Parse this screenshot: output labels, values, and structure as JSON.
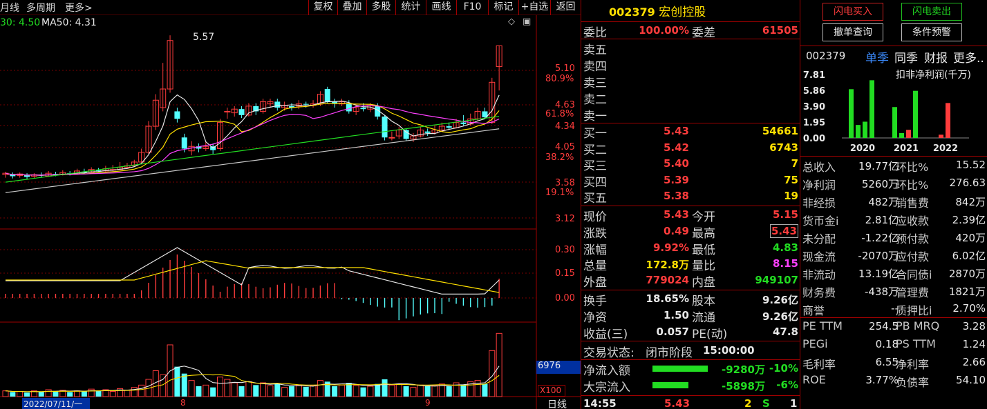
{
  "toolbar": {
    "left_items": [
      "月线",
      "多周期",
      "更多>"
    ],
    "buttons": [
      "复权",
      "叠加",
      "多股",
      "统计",
      "画线",
      "F10",
      "标记",
      "+自选",
      "返回"
    ]
  },
  "chart": {
    "ma_legend": [
      {
        "label": "30: 4.50",
        "color": "#22dd22"
      },
      {
        "label": "MA50: 4.31",
        "color": "#e0e0e0"
      }
    ],
    "peak_label": "5.57",
    "price_axis": [
      {
        "price": "5.10",
        "pct": "80.9%"
      },
      {
        "price": "4.63",
        "pct": "61.8%"
      },
      {
        "price": "4.34",
        "pct": ""
      },
      {
        "price": "4.05",
        "pct": "38.2%"
      },
      {
        "price": "3.58",
        "pct": "19.1%"
      },
      {
        "price": "3.12",
        "pct": ""
      }
    ],
    "macd_axis": [
      "0.30",
      "0.15",
      "0.00"
    ],
    "volume_box": "6976",
    "volume_unit": "X100",
    "date_label": "2022/07/11/一",
    "month_labels": [
      "8",
      "9"
    ],
    "period_label": "日线"
  },
  "quote": {
    "code": "002379",
    "name": "宏创控股",
    "weibi_label": "委比",
    "weibi_value": "100.00%",
    "weicha_label": "委差",
    "weicha_value": "61505",
    "asks": [
      {
        "label": "卖五",
        "price": "",
        "vol": ""
      },
      {
        "label": "卖四",
        "price": "",
        "vol": ""
      },
      {
        "label": "卖三",
        "price": "",
        "vol": ""
      },
      {
        "label": "卖二",
        "price": "",
        "vol": ""
      },
      {
        "label": "卖一",
        "price": "",
        "vol": ""
      }
    ],
    "bids": [
      {
        "label": "买一",
        "price": "5.43",
        "vol": "54661"
      },
      {
        "label": "买二",
        "price": "5.42",
        "vol": "6743"
      },
      {
        "label": "买三",
        "price": "5.40",
        "vol": "7"
      },
      {
        "label": "买四",
        "price": "5.39",
        "vol": "75"
      },
      {
        "label": "买五",
        "price": "5.38",
        "vol": "19"
      }
    ],
    "stats": [
      {
        "l1": "现价",
        "v1": "5.43",
        "c1": "red",
        "l2": "今开",
        "v2": "5.15",
        "c2": "red"
      },
      {
        "l1": "涨跌",
        "v1": "0.49",
        "c1": "red",
        "l2": "最高",
        "v2": "5.43",
        "c2": "red"
      },
      {
        "l1": "涨幅",
        "v1": "9.92%",
        "c1": "red",
        "l2": "最低",
        "v2": "4.83",
        "c2": "green"
      },
      {
        "l1": "总量",
        "v1": "172.8万",
        "c1": "yellow",
        "l2": "量比",
        "v2": "8.15",
        "c2": "magenta"
      },
      {
        "l1": "外盘",
        "v1": "779024",
        "c1": "red",
        "l2": "内盘",
        "v2": "949107",
        "c2": "green"
      }
    ],
    "stats2": [
      {
        "l1": "换手",
        "v1": "18.65%",
        "l2": "股本",
        "v2": "9.26亿"
      },
      {
        "l1": "净资",
        "v1": "1.50",
        "l2": "流通",
        "v2": "9.26亿"
      },
      {
        "l1": "收益(三)",
        "v1": "0.057",
        "l2": "PE(动)",
        "v2": "47.8"
      }
    ],
    "trade_status_label": "交易状态:",
    "trade_status_value": "闭市阶段",
    "trade_status_time": "15:00:00",
    "flows": [
      {
        "label": "净流入额",
        "value": "-9280万",
        "pct": "-10%",
        "bar": 0.85
      },
      {
        "label": "大宗流入",
        "value": "-5898万",
        "pct": "-6%",
        "bar": 0.55
      }
    ],
    "tick": {
      "time": "14:55",
      "price": "5.43",
      "vol": "2",
      "side": "S",
      "num": "1"
    }
  },
  "finance": {
    "flash_buy": "闪电买入",
    "flash_sell": "闪电卖出",
    "cancel_query": "撤单查询",
    "condition_alert": "条件预警",
    "tabs": [
      "002379",
      "单季",
      "同季",
      "财报",
      "更多.."
    ],
    "bar_chart_title": "扣非净利润(千万)",
    "bar_y_ticks": [
      "7.81",
      "5.86",
      "3.90",
      "1.95",
      "0.00"
    ],
    "bar_years": [
      "2020",
      "2021",
      "2022"
    ],
    "rows": [
      {
        "l1": "总收入",
        "v1": "19.77亿",
        "l2": "环比%",
        "v2": "15.52"
      },
      {
        "l1": "净利润",
        "v1": "5260万",
        "l2": "环比%",
        "v2": "276.63"
      },
      {
        "l1": "非经损",
        "v1": "482万",
        "l2": "销售费",
        "v2": "842万"
      },
      {
        "l1": "货币金i",
        "v1": "2.81亿",
        "l2": "应收款",
        "v2": "2.39亿"
      },
      {
        "l1": "未分配",
        "v1": "-1.22亿",
        "l2": "预付款",
        "v2": "420万"
      },
      {
        "l1": "现金流",
        "v1": "-2070万",
        "l2": "应付款",
        "v2": "6.02亿"
      },
      {
        "l1": "非流动",
        "v1": "13.19亿",
        "l2": "合同债i",
        "v2": "2870万"
      },
      {
        "l1": "财务费",
        "v1": "-438万",
        "l2": "管理费",
        "v2": "1821万"
      },
      {
        "l1": "商誉",
        "v1": "--",
        "l2": "质押比i",
        "v2": "2.70%"
      },
      {
        "l1": "PE TTM",
        "v1": "254.5",
        "l2": "PB MRQ",
        "v2": "3.28"
      },
      {
        "l1": "PEGi",
        "v1": "0.18",
        "l2": "PS TTM",
        "v2": "1.24"
      },
      {
        "l1": "毛利率",
        "v1": "6.55",
        "l2": "净利率",
        "v2": "2.66"
      },
      {
        "l1": "ROE",
        "v1": "3.77%",
        "l2": "负债率",
        "v2": "54.10"
      }
    ]
  },
  "chart_data": {
    "type": "bar",
    "title": "扣非净利润(千万)",
    "categories": [
      "2020",
      "2021",
      "2022"
    ],
    "series": [
      {
        "values": [
          6.0,
          1.6,
          2.0,
          7.1
        ],
        "group": "2020"
      },
      {
        "values": [
          3.8,
          0.6,
          1.0,
          5.8
        ],
        "group": "2021"
      },
      {
        "values": [
          0.4,
          4.3
        ],
        "group": "2022"
      }
    ],
    "ylim": [
      0,
      7.81
    ]
  }
}
